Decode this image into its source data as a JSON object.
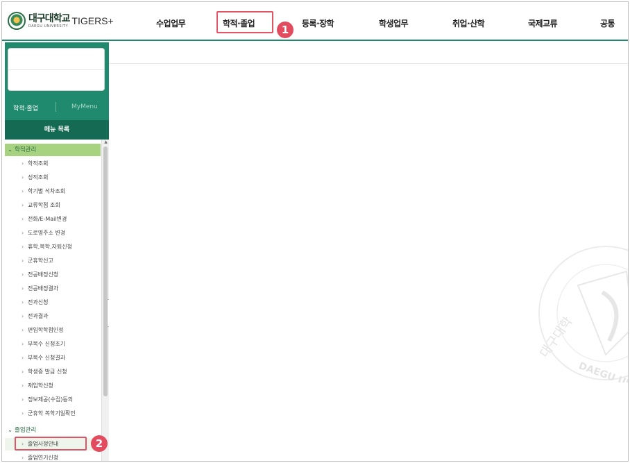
{
  "app": {
    "logo_kr": "대구대학교",
    "logo_en": "DAEGU UNIVERSITY",
    "logo_suffix": "TIGERS+"
  },
  "nav": {
    "items": [
      {
        "label": "수업업무"
      },
      {
        "label": "학적·졸업"
      },
      {
        "label": "등록·장학"
      },
      {
        "label": "학생업무"
      },
      {
        "label": "취업·산학"
      },
      {
        "label": "국제교류"
      },
      {
        "label": "공통"
      }
    ],
    "highlighted": "학적·졸업"
  },
  "annotations": {
    "step1": "1",
    "step2": "2",
    "color": "#e34c5f"
  },
  "sidebar": {
    "tab_active": "학적·졸업",
    "tab_other": "MyMenu",
    "menu_header": "메뉴 목록",
    "groups": [
      {
        "label": "학적관리",
        "items": [
          "학적조회",
          "성적조회",
          "학기별 석차조회",
          "교류학점 조회",
          "전화/E-Mail변경",
          "도로명주소 변경",
          "휴학,복학,자퇴신청",
          "군휴학신고",
          "전공배정신청",
          "전공배정결과",
          "전과신청",
          "전과결과",
          "편입학학점인정",
          "부복수 신청조기",
          "부복수 신청결과",
          "학생증 발급 신청",
          "재입학신청",
          "정보제공(수집)동의",
          "군휴학 복학기일확인"
        ]
      },
      {
        "label": "졸업관리",
        "items": [
          "졸업사정안내",
          "졸업연기신청"
        ]
      }
    ],
    "selected_item": "졸업사정안내",
    "collapse_glyph": "‹"
  },
  "watermark": {
    "text": "DAEGU UNIVERSITY",
    "kr": "대구대학"
  },
  "colors": {
    "brand_green": "#1f8a6e",
    "dark_green": "#146a52",
    "active_group": "#a7d27f",
    "highlight": "#e05466"
  }
}
